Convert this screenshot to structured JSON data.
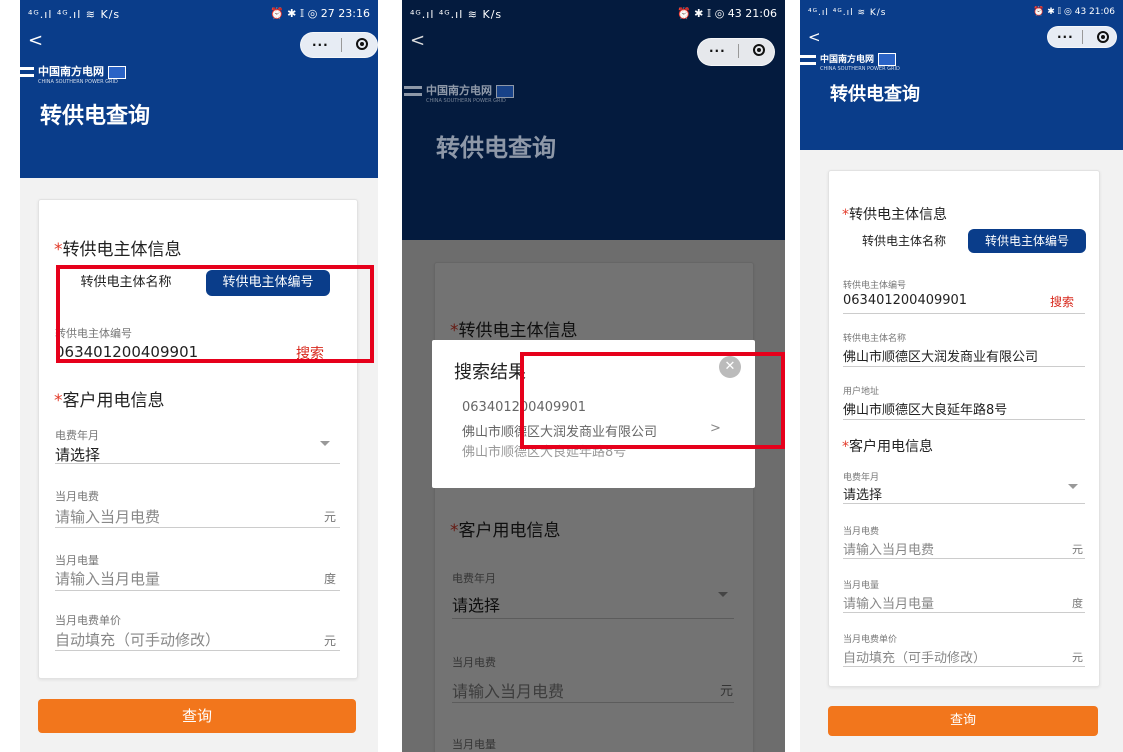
{
  "status": {
    "left": "⁴ᴳ.ıl ⁴ᴳ.ıl ≋ K/s",
    "right_1": "⏰ ✱ 𝕀 ◎ 27 23:16",
    "right_2": "⏰ ✱ 𝕀 ◎ 43 21:06",
    "right_3": "⏰ ✱ 𝕀 ◎ 43 21:06"
  },
  "nav": {
    "back": "<",
    "menu": "···"
  },
  "logo": {
    "name": "中国南方电网",
    "sub": "CHINA SOUTHERN POWER GRID"
  },
  "title": "转供电查询",
  "section_entity": "转供电主体信息",
  "tabs": {
    "name": "转供电主体名称",
    "number": "转供电主体编号"
  },
  "entity_number": {
    "label": "转供电主体编号",
    "value": "063401200409901",
    "search": "搜索"
  },
  "entity_name": {
    "label": "转供电主体名称",
    "value": "佛山市顺德区大润发商业有限公司"
  },
  "user_address": {
    "label": "用户地址",
    "value": "佛山市顺德区大良延年路8号"
  },
  "section_customer": "客户用电信息",
  "fee_month": {
    "label": "电费年月",
    "value": "请选择"
  },
  "month_fee": {
    "label": "当月电费",
    "placeholder": "请输入当月电费",
    "unit": "元"
  },
  "month_power": {
    "label": "当月电量",
    "placeholder": "请输入当月电量",
    "unit": "度"
  },
  "unit_price": {
    "label": "当月电费单价",
    "placeholder": "自动填充（可手动修改）",
    "unit": "元"
  },
  "query_button": "查询",
  "modal": {
    "title": "搜索结果",
    "close": "✕",
    "number": "063401200409901",
    "company": "佛山市顺德区大润发商业有限公司",
    "address": "佛山市顺德区大良延年路8号",
    "arrow": ">"
  },
  "colors": {
    "brand_blue": "#0a3d8a",
    "accent_orange": "#f2761c",
    "highlight_red": "#e6001b",
    "required_star": "#e23b2a"
  }
}
